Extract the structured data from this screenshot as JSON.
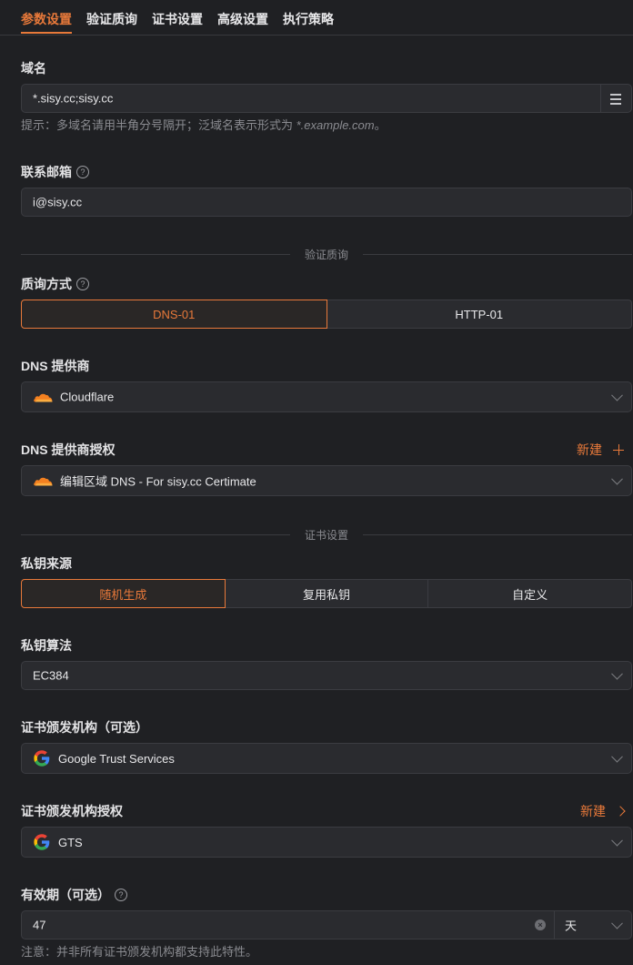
{
  "tabs": [
    "参数设置",
    "验证质询",
    "证书设置",
    "高级设置",
    "执行策略"
  ],
  "domain": {
    "label": "域名",
    "value": "*.sisy.cc;sisy.cc",
    "hint_prefix": "提示：多域名请用半角分号隔开；泛域名表示形式为 ",
    "hint_example": "*.example.com",
    "hint_suffix": "。"
  },
  "email": {
    "label": "联系邮箱",
    "value": "i@sisy.cc"
  },
  "section_challenge": "验证质询",
  "challenge": {
    "label": "质询方式",
    "options": [
      "DNS-01",
      "HTTP-01"
    ],
    "selected": 0
  },
  "dns_provider": {
    "label": "DNS 提供商",
    "value": "Cloudflare",
    "icon": "cloudflare-icon"
  },
  "dns_access": {
    "label": "DNS 提供商授权",
    "action": "新建",
    "value": "编辑区域 DNS - For sisy.cc Certimate",
    "icon": "cloudflare-icon"
  },
  "section_cert": "证书设置",
  "key_source": {
    "label": "私钥来源",
    "options": [
      "随机生成",
      "复用私钥",
      "自定义"
    ],
    "selected": 0
  },
  "key_algorithm": {
    "label": "私钥算法",
    "value": "EC384"
  },
  "ca": {
    "label": "证书颁发机构（可选）",
    "value": "Google Trust Services",
    "icon": "google-icon"
  },
  "ca_access": {
    "label": "证书颁发机构授权",
    "action": "新建",
    "value": "GTS",
    "icon": "google-icon"
  },
  "validity": {
    "label": "有效期（可选）",
    "value": "47",
    "unit": "天",
    "note": "注意：并非所有证书颁发机构都支持此特性。"
  },
  "colors": {
    "accent": "#e8793a",
    "background": "#1f2023",
    "field": "#2a2b2f",
    "border": "#3b3c41"
  }
}
